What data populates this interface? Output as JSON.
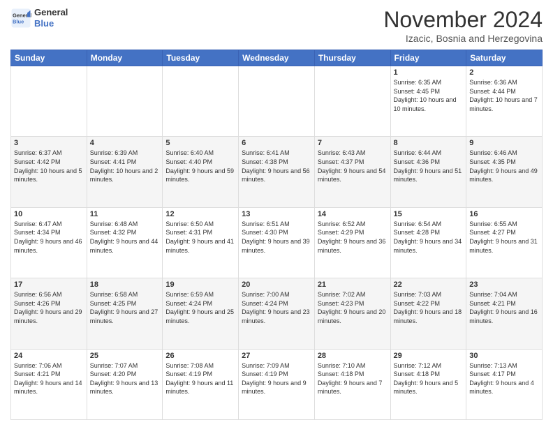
{
  "logo": {
    "text_general": "General",
    "text_blue": "Blue"
  },
  "header": {
    "month_title": "November 2024",
    "subtitle": "Izacic, Bosnia and Herzegovina"
  },
  "weekdays": [
    "Sunday",
    "Monday",
    "Tuesday",
    "Wednesday",
    "Thursday",
    "Friday",
    "Saturday"
  ],
  "weeks": [
    [
      {
        "day": "",
        "info": ""
      },
      {
        "day": "",
        "info": ""
      },
      {
        "day": "",
        "info": ""
      },
      {
        "day": "",
        "info": ""
      },
      {
        "day": "",
        "info": ""
      },
      {
        "day": "1",
        "info": "Sunrise: 6:35 AM\nSunset: 4:45 PM\nDaylight: 10 hours and 10 minutes."
      },
      {
        "day": "2",
        "info": "Sunrise: 6:36 AM\nSunset: 4:44 PM\nDaylight: 10 hours and 7 minutes."
      }
    ],
    [
      {
        "day": "3",
        "info": "Sunrise: 6:37 AM\nSunset: 4:42 PM\nDaylight: 10 hours and 5 minutes."
      },
      {
        "day": "4",
        "info": "Sunrise: 6:39 AM\nSunset: 4:41 PM\nDaylight: 10 hours and 2 minutes."
      },
      {
        "day": "5",
        "info": "Sunrise: 6:40 AM\nSunset: 4:40 PM\nDaylight: 9 hours and 59 minutes."
      },
      {
        "day": "6",
        "info": "Sunrise: 6:41 AM\nSunset: 4:38 PM\nDaylight: 9 hours and 56 minutes."
      },
      {
        "day": "7",
        "info": "Sunrise: 6:43 AM\nSunset: 4:37 PM\nDaylight: 9 hours and 54 minutes."
      },
      {
        "day": "8",
        "info": "Sunrise: 6:44 AM\nSunset: 4:36 PM\nDaylight: 9 hours and 51 minutes."
      },
      {
        "day": "9",
        "info": "Sunrise: 6:46 AM\nSunset: 4:35 PM\nDaylight: 9 hours and 49 minutes."
      }
    ],
    [
      {
        "day": "10",
        "info": "Sunrise: 6:47 AM\nSunset: 4:34 PM\nDaylight: 9 hours and 46 minutes."
      },
      {
        "day": "11",
        "info": "Sunrise: 6:48 AM\nSunset: 4:32 PM\nDaylight: 9 hours and 44 minutes."
      },
      {
        "day": "12",
        "info": "Sunrise: 6:50 AM\nSunset: 4:31 PM\nDaylight: 9 hours and 41 minutes."
      },
      {
        "day": "13",
        "info": "Sunrise: 6:51 AM\nSunset: 4:30 PM\nDaylight: 9 hours and 39 minutes."
      },
      {
        "day": "14",
        "info": "Sunrise: 6:52 AM\nSunset: 4:29 PM\nDaylight: 9 hours and 36 minutes."
      },
      {
        "day": "15",
        "info": "Sunrise: 6:54 AM\nSunset: 4:28 PM\nDaylight: 9 hours and 34 minutes."
      },
      {
        "day": "16",
        "info": "Sunrise: 6:55 AM\nSunset: 4:27 PM\nDaylight: 9 hours and 31 minutes."
      }
    ],
    [
      {
        "day": "17",
        "info": "Sunrise: 6:56 AM\nSunset: 4:26 PM\nDaylight: 9 hours and 29 minutes."
      },
      {
        "day": "18",
        "info": "Sunrise: 6:58 AM\nSunset: 4:25 PM\nDaylight: 9 hours and 27 minutes."
      },
      {
        "day": "19",
        "info": "Sunrise: 6:59 AM\nSunset: 4:24 PM\nDaylight: 9 hours and 25 minutes."
      },
      {
        "day": "20",
        "info": "Sunrise: 7:00 AM\nSunset: 4:24 PM\nDaylight: 9 hours and 23 minutes."
      },
      {
        "day": "21",
        "info": "Sunrise: 7:02 AM\nSunset: 4:23 PM\nDaylight: 9 hours and 20 minutes."
      },
      {
        "day": "22",
        "info": "Sunrise: 7:03 AM\nSunset: 4:22 PM\nDaylight: 9 hours and 18 minutes."
      },
      {
        "day": "23",
        "info": "Sunrise: 7:04 AM\nSunset: 4:21 PM\nDaylight: 9 hours and 16 minutes."
      }
    ],
    [
      {
        "day": "24",
        "info": "Sunrise: 7:06 AM\nSunset: 4:21 PM\nDaylight: 9 hours and 14 minutes."
      },
      {
        "day": "25",
        "info": "Sunrise: 7:07 AM\nSunset: 4:20 PM\nDaylight: 9 hours and 13 minutes."
      },
      {
        "day": "26",
        "info": "Sunrise: 7:08 AM\nSunset: 4:19 PM\nDaylight: 9 hours and 11 minutes."
      },
      {
        "day": "27",
        "info": "Sunrise: 7:09 AM\nSunset: 4:19 PM\nDaylight: 9 hours and 9 minutes."
      },
      {
        "day": "28",
        "info": "Sunrise: 7:10 AM\nSunset: 4:18 PM\nDaylight: 9 hours and 7 minutes."
      },
      {
        "day": "29",
        "info": "Sunrise: 7:12 AM\nSunset: 4:18 PM\nDaylight: 9 hours and 5 minutes."
      },
      {
        "day": "30",
        "info": "Sunrise: 7:13 AM\nSunset: 4:17 PM\nDaylight: 9 hours and 4 minutes."
      }
    ]
  ]
}
